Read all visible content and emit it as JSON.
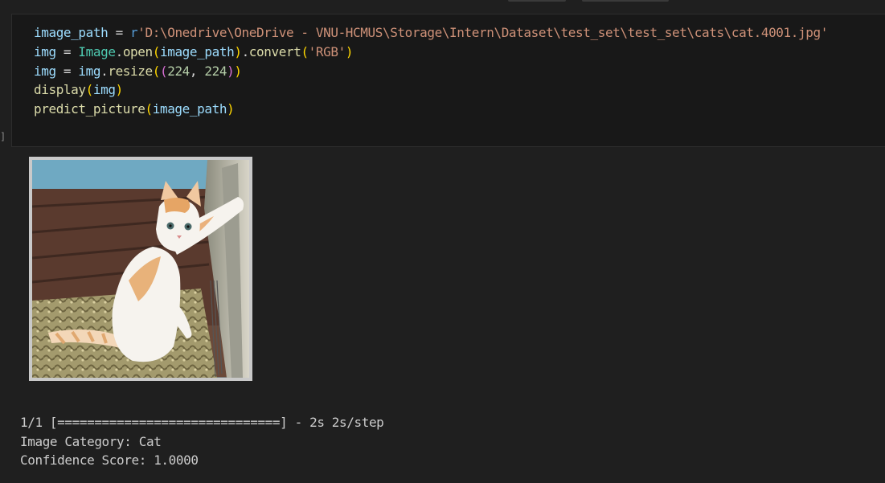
{
  "cell": {
    "bracket": "]",
    "code": {
      "line1": {
        "var": "image_path",
        "op": " = ",
        "prefix": "r",
        "string": "'D:\\Onedrive\\OneDrive - VNU-HCMUS\\Storage\\Intern\\Dataset\\test_set\\test_set\\cats\\cat.4001.jpg'"
      },
      "line2": {
        "var": "img",
        "op": " = ",
        "cls": "Image",
        "dot1": ".",
        "fn1": "open",
        "p1": "(",
        "arg1": "image_path",
        "p2": ")",
        "dot2": ".",
        "fn2": "convert",
        "p3": "(",
        "arg2": "'RGB'",
        "p4": ")"
      },
      "line3": {
        "var": "img",
        "op": " = ",
        "obj": "img",
        "dot": ".",
        "fn": "resize",
        "p1": "(",
        "p2": "(",
        "n1": "224",
        "comma": ", ",
        "n2": "224",
        "p3": ")",
        "p4": ")"
      },
      "line4": {
        "fn": "display",
        "p1": "(",
        "arg": "img",
        "p2": ")"
      },
      "line5": {
        "fn": "predict_picture",
        "p1": "(",
        "arg": "image_path",
        "p2": ")"
      }
    }
  },
  "output": {
    "image_alt": "cat.4001.jpg",
    "progress_line": "1/1 [==============================] - 2s 2s/step",
    "category_line": "Image Category: Cat",
    "confidence_line": "Confidence Score: 1.0000"
  },
  "colors": {
    "background": "#1f1f1f",
    "cell_background": "#181818",
    "variable": "#9cdcfe",
    "keyword": "#569cd6",
    "string": "#ce9178",
    "class": "#4ec9b0",
    "function": "#dcdcaa",
    "bracket_1": "#ffd700",
    "bracket_2": "#da70d6",
    "number": "#b5cea8"
  }
}
